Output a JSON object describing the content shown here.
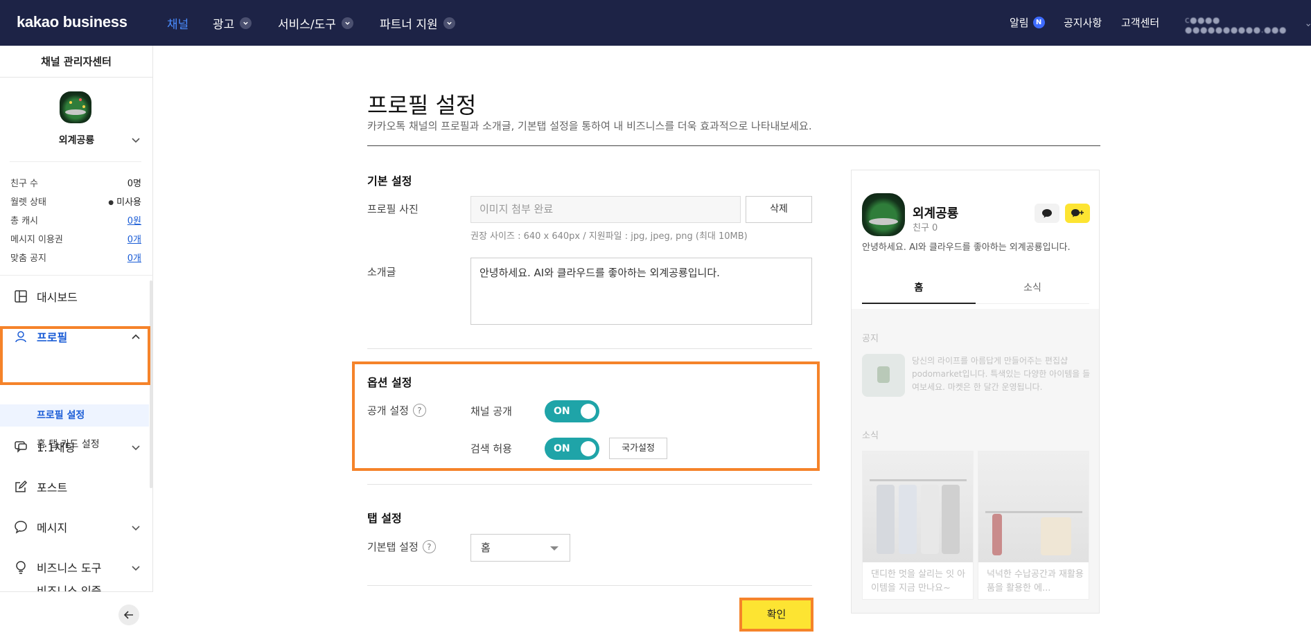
{
  "topnav": {
    "logo": "kakao business",
    "items": [
      "채널",
      "광고",
      "서비스/도구",
      "파트너 지원"
    ],
    "alert_label": "알림",
    "alert_badge": "N",
    "notice_label": "공지사항",
    "support_label": "고객센터",
    "account_blurred": "c●●●● ●●●●●●●●●●.●●●"
  },
  "sidebar": {
    "title": "채널 관리자센터",
    "channel_name": "외계공룡",
    "stats": [
      {
        "label": "친구 수",
        "value": "0명"
      },
      {
        "label": "월렛 상태",
        "value": "미사용"
      },
      {
        "label": "총 캐시",
        "value": "0원"
      },
      {
        "label": "메시지 이용권",
        "value": "0개"
      },
      {
        "label": "맞춤 공지",
        "value": "0개"
      }
    ],
    "menu": {
      "dashboard": "대시보드",
      "profile": "프로필",
      "profile_settings": "프로필 설정",
      "home_tab_card": "홈 탭 카드 설정",
      "chat": "1:1채팅",
      "post": "포스트",
      "message": "메시지",
      "business_tools": "비즈니스 도구",
      "partial": "비즈니스 인증"
    },
    "highlight_color": "#f5832a"
  },
  "main": {
    "title": "프로필 설정",
    "subtitle": "카카오톡 채널의 프로필과 소개글, 기본탭 설정을 통하여 내 비즈니스를 더욱 효과적으로 나타내보세요.",
    "basic": {
      "heading": "기본 설정",
      "photo_label": "프로필 사진",
      "photo_placeholder": "이미지 첨부 완료",
      "delete_button": "삭제",
      "hint": "권장 사이즈 : 640 x 640px / 지원파일 : jpg, jpeg, png (최대 10MB)",
      "intro_label": "소개글",
      "intro_value": "안녕하세요. AI와 클라우드를 좋아하는 외계공룡입니다."
    },
    "options": {
      "heading": "옵션 설정",
      "visibility_label": "공개 설정",
      "channel_public_label": "채널 공개",
      "channel_public_state": "ON",
      "search_allow_label": "검색 허용",
      "search_allow_state": "ON",
      "country_button": "국가설정"
    },
    "tabs": {
      "heading": "탭 설정",
      "default_tab_label": "기본탭 설정",
      "default_tab_value": "홈"
    },
    "confirm_button": "확인"
  },
  "preview": {
    "name": "외계공룡",
    "friends": "친구 0",
    "intro": "안녕하세요. AI와 클라우드를 좋아하는 외계공룡입니다.",
    "tabs": [
      "홈",
      "소식"
    ],
    "notice_label": "공지",
    "notice_text": "당신의 라이프를 아름답게 만들어주는 편집샵 podomarket입니다. 특색있는 다양한 아이템을 들여보세요. 마켓은 한 달간 운영됩니다.",
    "news_label": "소식",
    "news_cards": [
      "댄디한 멋을 살리는 잇 아이템을 지금 만나요~",
      "넉넉한 수납공간과 재활용품을 활용한 에..."
    ]
  },
  "colors": {
    "nav_bg": "#1d2346",
    "toggle_on": "#1fa4a8",
    "confirm_bg": "#fde432",
    "link_blue": "#1a5cd6"
  }
}
